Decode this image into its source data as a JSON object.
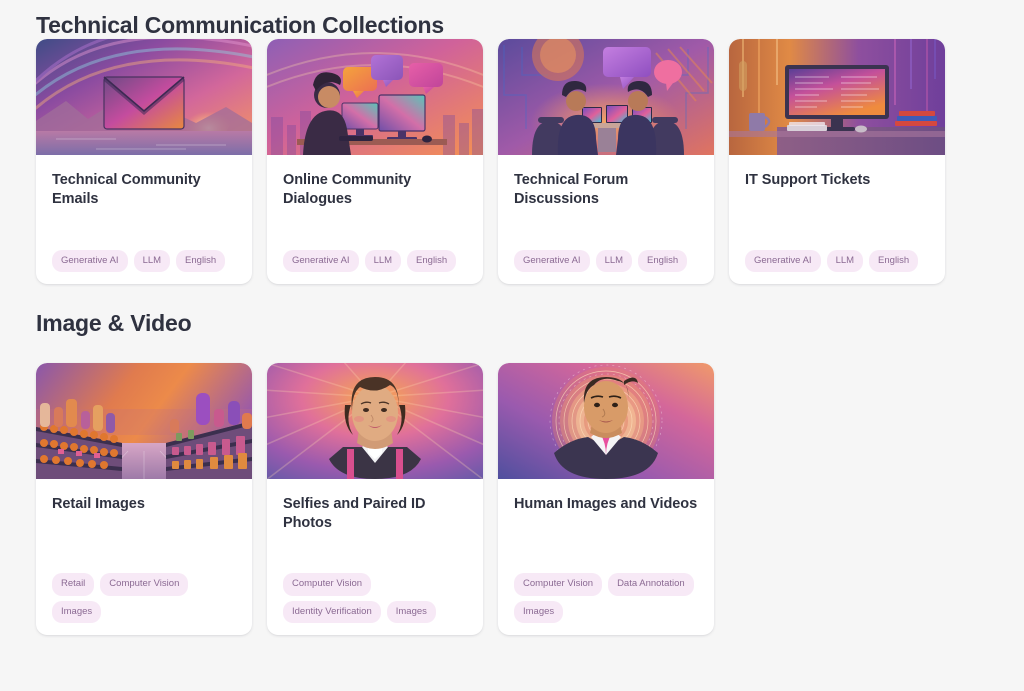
{
  "page": {
    "background_color": "#f6f6f6",
    "card_background": "#ffffff",
    "title_color": "#2f3240",
    "tag_background": "#f7e9f6",
    "tag_text_color": "#8b6a93"
  },
  "sections": [
    {
      "title": "Technical Communication Collections",
      "cards": [
        {
          "title": "Technical Community Emails",
          "thumbnail": "envelope-sunset-illustration",
          "tags": [
            "Generative AI",
            "LLM",
            "English"
          ]
        },
        {
          "title": "Online Community Dialogues",
          "thumbnail": "person-at-computer-speech-bubbles-illustration",
          "tags": [
            "Generative AI",
            "LLM",
            "English"
          ]
        },
        {
          "title": "Technical Forum Discussions",
          "thumbnail": "two-people-at-table-monitors-illustration",
          "tags": [
            "Generative AI",
            "LLM",
            "English"
          ]
        },
        {
          "title": "IT Support Tickets",
          "thumbnail": "desk-monitor-mug-books-illustration",
          "tags": [
            "Generative AI",
            "LLM",
            "English"
          ]
        }
      ]
    },
    {
      "title": "Image & Video",
      "cards": [
        {
          "title": "Retail Images",
          "thumbnail": "retail-store-aisle-shelves-illustration",
          "tags": [
            "Retail",
            "Computer Vision",
            "Images"
          ]
        },
        {
          "title": "Selfies and Paired ID Photos",
          "thumbnail": "woman-portrait-sunburst-illustration",
          "tags": [
            "Computer Vision",
            "Identity Verification",
            "Images"
          ]
        },
        {
          "title": "Human Images and Videos",
          "thumbnail": "man-portrait-concentric-circles-illustration",
          "tags": [
            "Computer Vision",
            "Data Annotation",
            "Images"
          ]
        }
      ]
    }
  ]
}
